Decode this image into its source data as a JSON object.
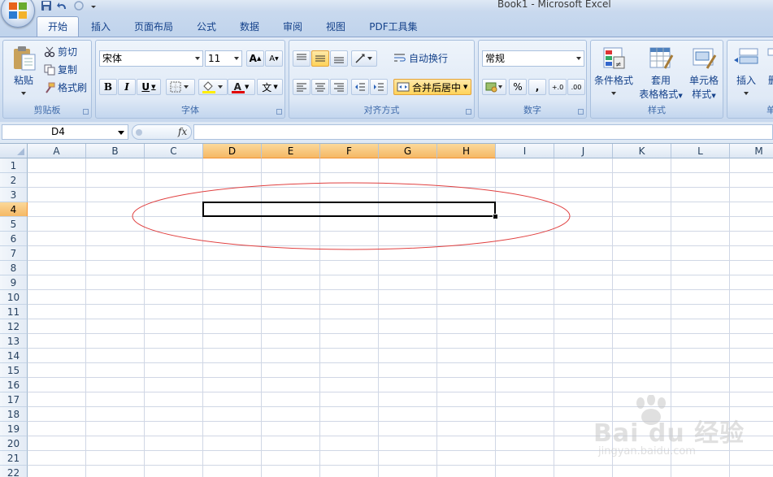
{
  "window": {
    "title": "Book1 - Microsoft Excel"
  },
  "tabs": [
    "开始",
    "插入",
    "页面布局",
    "公式",
    "数据",
    "审阅",
    "视图",
    "PDF工具集"
  ],
  "active_tab": "开始",
  "ribbon": {
    "clipboard": {
      "label": "剪贴板",
      "paste": "粘贴",
      "cut": "剪切",
      "copy": "复制",
      "format_painter": "格式刷"
    },
    "font": {
      "label": "字体",
      "font_name": "宋体",
      "font_size": "11",
      "bold": "B",
      "italic": "I",
      "underline": "U",
      "grow": "A",
      "shrink": "A",
      "font_color_glyph": "A",
      "phonetic_glyph": "文"
    },
    "alignment": {
      "label": "对齐方式",
      "wrap_text": "自动换行",
      "merge_center": "合并后居中"
    },
    "number": {
      "label": "数字",
      "format": "常规",
      "percent": "%",
      "comma": ",",
      "inc_decimal": "+.0",
      "dec_decimal": ".00"
    },
    "styles": {
      "label": "样式",
      "conditional": "条件格式",
      "table_format_1": "套用",
      "table_format_2": "表格格式",
      "cell_styles_1": "单元格",
      "cell_styles_2": "样式"
    },
    "cells": {
      "label": "单",
      "insert": "插入",
      "delete_partial": "删"
    }
  },
  "formula_bar": {
    "name_box": "D4",
    "fx": "fx",
    "formula": ""
  },
  "sheet": {
    "columns": [
      "A",
      "B",
      "C",
      "D",
      "E",
      "F",
      "G",
      "H",
      "I",
      "J",
      "K",
      "L",
      "M"
    ],
    "rows": [
      "1",
      "2",
      "3",
      "4",
      "5",
      "6",
      "7",
      "8",
      "9",
      "10",
      "11",
      "12",
      "13",
      "14",
      "15",
      "16",
      "17",
      "18",
      "19",
      "20",
      "21",
      "22"
    ],
    "selected_columns": [
      "D",
      "E",
      "F",
      "G",
      "H"
    ],
    "selected_row": "4",
    "selection_range": "D4:H4"
  },
  "annotation": {
    "color": "#e04040"
  },
  "watermark": {
    "text": "Bai du 经验",
    "url": "jingyan.baidu.com"
  },
  "colors": {
    "accent": "#15428b",
    "selected_header": "#f5b865",
    "highlight_button": "#ffd35a"
  }
}
